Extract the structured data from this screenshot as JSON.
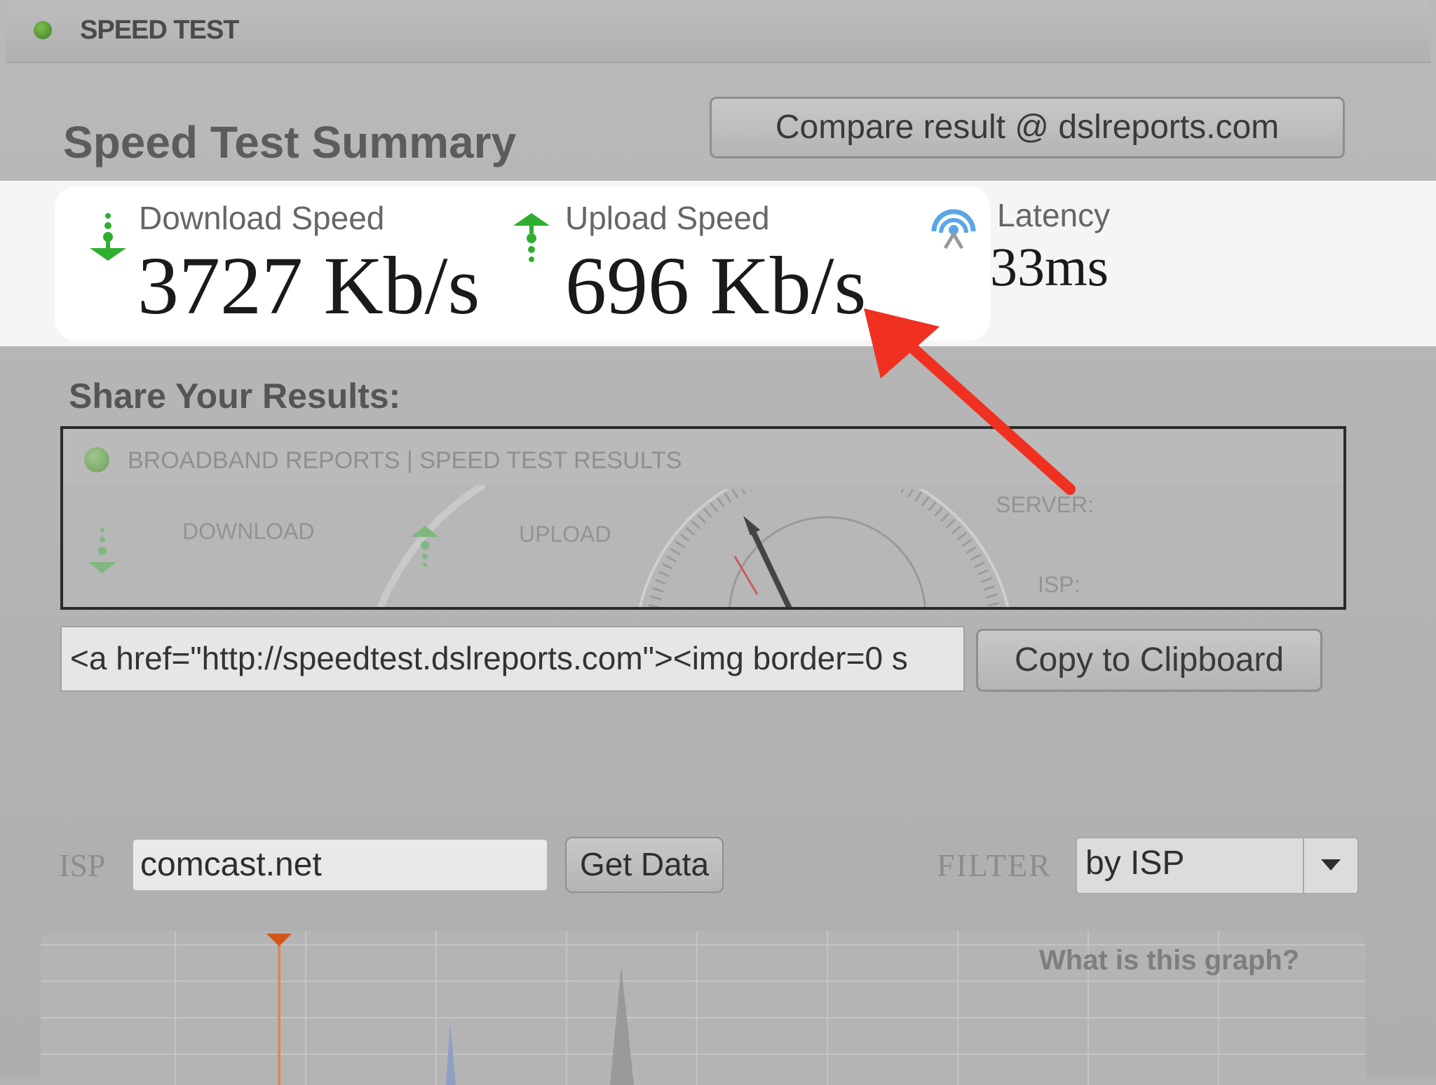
{
  "window": {
    "title": "SPEED TEST"
  },
  "summary": {
    "title": "Speed Test Summary",
    "compare_button": "Compare result @ dslreports.com"
  },
  "metrics": {
    "download": {
      "label": "Download Speed",
      "value": "3727 Kb/s"
    },
    "upload": {
      "label": "Upload Speed",
      "value": "696 Kb/s"
    },
    "latency": {
      "label": "Latency",
      "value": "33ms"
    }
  },
  "share": {
    "title": "Share Your Results:",
    "preview": {
      "header": "BROADBAND REPORTS | SPEED TEST RESULTS",
      "download_label": "DOWNLOAD",
      "upload_label": "UPLOAD",
      "server_label": "SERVER:",
      "isp_label": "ISP:"
    },
    "embed_code": "<a href=\"http://speedtest.dslreports.com\"><img border=0 s",
    "copy_button": "Copy to Clipboard"
  },
  "controls": {
    "isp_label": "ISP",
    "isp_value": "comcast.net",
    "get_data_button": "Get Data",
    "filter_label": "FILTER",
    "filter_value": "by ISP"
  },
  "graph": {
    "help_link": "What is this graph?"
  },
  "colors": {
    "download_green": "#33b233",
    "annotation_red": "#f03020",
    "dimmed_bg": "#b3b3b3"
  },
  "icons": [
    "download-arrow-icon",
    "upload-arrow-icon",
    "latency-antenna-icon",
    "annotation-arrow"
  ]
}
